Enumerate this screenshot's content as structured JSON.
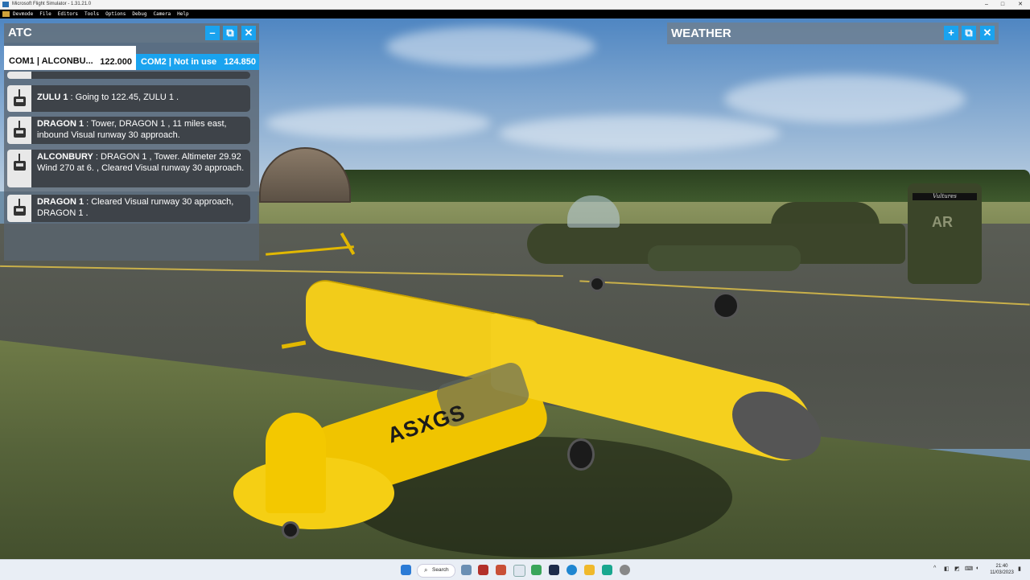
{
  "window": {
    "title": "Microsoft Flight Simulator - 1.31.21.0",
    "controls": {
      "minimize": "–",
      "maximize": "□",
      "close": "✕"
    }
  },
  "menubar": {
    "items": [
      "Devmode",
      "File",
      "Editors",
      "Tools",
      "Options",
      "Debug",
      "Camera",
      "Help"
    ]
  },
  "atc": {
    "title": "ATC",
    "buttons": {
      "minimize": "–",
      "popout": "⧉",
      "close": "✕"
    },
    "com1": {
      "label": "COM1 | ALCONBU...",
      "freq": "122.000"
    },
    "com2": {
      "label": "COM2 | Not in use",
      "freq": "124.850"
    },
    "messages": [
      {
        "speaker": "ZULU 1",
        "text": " : Going to 122.45, ZULU 1 ."
      },
      {
        "speaker": "DRAGON 1",
        "text": " : Tower, DRAGON 1 , 11 miles east, inbound Visual runway 30 approach."
      },
      {
        "speaker": "ALCONBURY",
        "text": " : DRAGON 1 , Tower. Altimeter 29.92 Wind 270 at 6. , Cleared Visual runway 30 approach."
      },
      {
        "speaker": "DRAGON 1",
        "text": " : Cleared Visual runway 30 approach, DRAGON 1 ."
      }
    ]
  },
  "weather": {
    "title": "WEATHER",
    "buttons": {
      "add": "+",
      "popout": "⧉",
      "close": "✕"
    }
  },
  "scene": {
    "aircraft_registration": "ASXGS",
    "jet_tail_code": "AR",
    "jet_tail_band": "Vultures"
  },
  "taskbar": {
    "search_label": "Search",
    "time": "21:40",
    "date": "11/03/2023"
  }
}
